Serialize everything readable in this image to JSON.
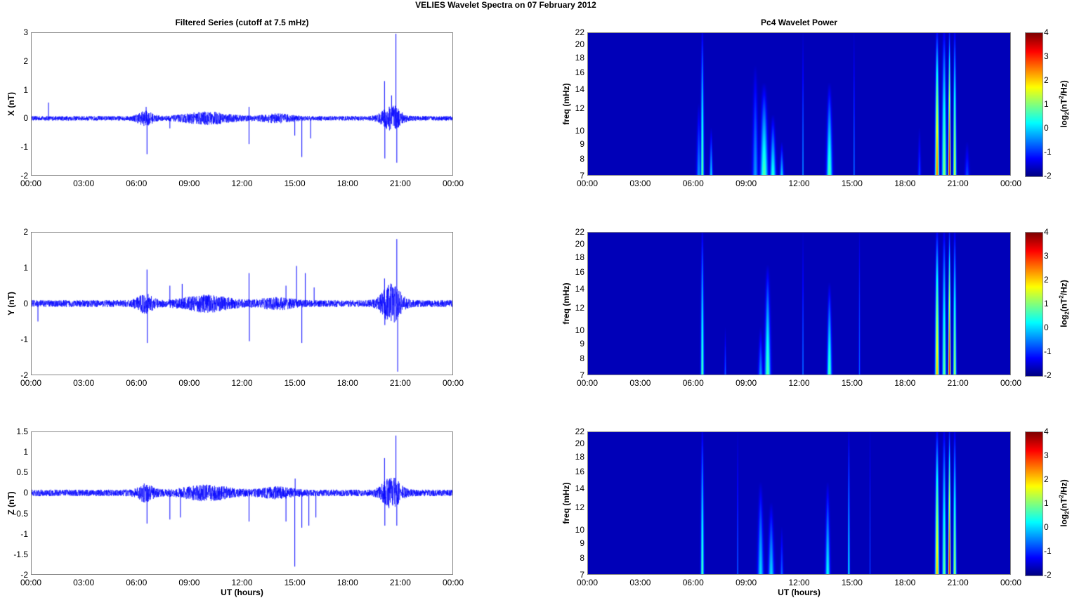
{
  "title": "VELIES Wavelet Spectra on 07 February  2012",
  "colors": {
    "trace": "#0000ff",
    "axis": "#888888"
  },
  "chart_data": [
    {
      "type": "line",
      "title": "Filtered Series (cutoff at 7.5 mHz)",
      "ylabel": "X (nT)",
      "xlabel": "",
      "ylim": [
        -2,
        3
      ],
      "yticks": [
        "-2",
        "-1",
        "0",
        "1",
        "2",
        "3"
      ],
      "ytick_values": [
        -2,
        -1,
        0,
        1,
        2,
        3
      ],
      "xlim": [
        0,
        24
      ],
      "xticks": [
        "00:00",
        "03:00",
        "06:00",
        "09:00",
        "12:00",
        "15:00",
        "18:00",
        "21:00",
        "00:00"
      ],
      "noise": 0.05,
      "bursts": [
        [
          6.5,
          0.12,
          0.5
        ],
        [
          10,
          0.1,
          1.5
        ],
        [
          14,
          0.06,
          1
        ],
        [
          20.5,
          0.25,
          0.6
        ]
      ],
      "spikes": [
        [
          1.0,
          0.55
        ],
        [
          6.55,
          0.4
        ],
        [
          6.6,
          -1.25
        ],
        [
          7.9,
          -0.35
        ],
        [
          12.4,
          -0.9
        ],
        [
          12.4,
          0.4
        ],
        [
          15.0,
          -0.6
        ],
        [
          15.4,
          -1.35
        ],
        [
          15.9,
          -0.7
        ],
        [
          20.1,
          1.3
        ],
        [
          20.12,
          -1.4
        ],
        [
          20.5,
          0.8
        ],
        [
          20.75,
          2.95
        ],
        [
          20.8,
          -1.55
        ]
      ]
    },
    {
      "type": "heatmap",
      "title": "Pc4 Wavelet Power",
      "ylabel": "freq (mHz)",
      "xlabel": "",
      "ylim": [
        7,
        22
      ],
      "yscale": "log",
      "yticks": [
        "7",
        "8",
        "9",
        "10",
        "12",
        "14",
        "16",
        "18",
        "20",
        "22"
      ],
      "ytick_values": [
        7,
        8,
        9,
        10,
        12,
        14,
        16,
        18,
        20,
        22
      ],
      "xlim": [
        0,
        24
      ],
      "xticks": [
        "00:00",
        "03:00",
        "06:00",
        "09:00",
        "12:00",
        "15:00",
        "18:00",
        "21:00",
        "00:00"
      ],
      "colorbar": {
        "label": "log2(nT2/Hz)",
        "range": [
          -2,
          4
        ],
        "ticks": [
          "-2",
          "-1",
          "0",
          "1",
          "2",
          "3",
          "4"
        ]
      },
      "events": [
        [
          6.5,
          1,
          22,
          0.08
        ],
        [
          6.3,
          -0.5,
          12,
          0.12
        ],
        [
          7.0,
          0,
          10,
          0.08
        ],
        [
          9.5,
          -0.5,
          16,
          0.15
        ],
        [
          10.0,
          0.8,
          14,
          0.2
        ],
        [
          10.5,
          0.5,
          11,
          0.15
        ],
        [
          11.0,
          0,
          9,
          0.1
        ],
        [
          12.2,
          0,
          22,
          0.03
        ],
        [
          13.7,
          0.8,
          14,
          0.15
        ],
        [
          15.1,
          -0.3,
          22,
          0.03
        ],
        [
          18.8,
          -1,
          10,
          0.08
        ],
        [
          19.8,
          3,
          22,
          0.1
        ],
        [
          20.2,
          1.2,
          22,
          0.12
        ],
        [
          20.5,
          4,
          22,
          0.06
        ],
        [
          20.8,
          1.8,
          22,
          0.08
        ],
        [
          21.5,
          -1,
          9,
          0.12
        ]
      ]
    },
    {
      "type": "line",
      "title": "",
      "ylabel": "Y (nT)",
      "xlabel": "",
      "ylim": [
        -2,
        2
      ],
      "yticks": [
        "-2",
        "-1",
        "0",
        "1",
        "2"
      ],
      "ytick_values": [
        -2,
        -1,
        0,
        1,
        2
      ],
      "xlim": [
        0,
        24
      ],
      "xticks": [
        "00:00",
        "03:00",
        "06:00",
        "09:00",
        "12:00",
        "15:00",
        "18:00",
        "21:00",
        "00:00"
      ],
      "noise": 0.06,
      "bursts": [
        [
          6.5,
          0.12,
          0.5
        ],
        [
          10,
          0.1,
          1.5
        ],
        [
          14,
          0.06,
          1
        ],
        [
          20.5,
          0.3,
          0.6
        ]
      ],
      "spikes": [
        [
          0.4,
          -0.5
        ],
        [
          6.6,
          0.95
        ],
        [
          6.62,
          -1.1
        ],
        [
          7.9,
          0.5
        ],
        [
          8.6,
          0.55
        ],
        [
          12.4,
          0.85
        ],
        [
          12.42,
          -1.05
        ],
        [
          14.5,
          0.5
        ],
        [
          15.1,
          1.05
        ],
        [
          15.4,
          -1.1
        ],
        [
          15.6,
          0.85
        ],
        [
          16.1,
          0.45
        ],
        [
          20.1,
          0.7
        ],
        [
          20.12,
          -0.6
        ],
        [
          20.8,
          1.8
        ],
        [
          20.85,
          -1.9
        ]
      ]
    },
    {
      "type": "heatmap",
      "title": "",
      "ylabel": "freq (mHz)",
      "xlabel": "",
      "ylim": [
        7,
        22
      ],
      "yscale": "log",
      "yticks": [
        "7",
        "8",
        "9",
        "10",
        "12",
        "14",
        "16",
        "18",
        "20",
        "22"
      ],
      "ytick_values": [
        7,
        8,
        9,
        10,
        12,
        14,
        16,
        18,
        20,
        22
      ],
      "xlim": [
        0,
        24
      ],
      "xticks": [
        "00:00",
        "03:00",
        "06:00",
        "09:00",
        "12:00",
        "15:00",
        "18:00",
        "21:00",
        "00:00"
      ],
      "colorbar": {
        "label": "log2(nT2/Hz)",
        "range": [
          -2,
          4
        ],
        "ticks": [
          "-2",
          "-1",
          "0",
          "1",
          "2",
          "3",
          "4"
        ]
      },
      "events": [
        [
          6.5,
          0.8,
          22,
          0.08
        ],
        [
          7.8,
          -0.8,
          10,
          0.05
        ],
        [
          9.8,
          -0.5,
          10,
          0.12
        ],
        [
          10.2,
          0.8,
          16,
          0.15
        ],
        [
          12.2,
          -0.3,
          22,
          0.03
        ],
        [
          13.7,
          0.8,
          14,
          0.12
        ],
        [
          15.4,
          -0.8,
          22,
          0.04
        ],
        [
          19.8,
          2.5,
          22,
          0.1
        ],
        [
          20.2,
          1,
          22,
          0.1
        ],
        [
          20.5,
          3.8,
          22,
          0.06
        ],
        [
          20.8,
          1.5,
          22,
          0.08
        ]
      ]
    },
    {
      "type": "line",
      "title": "",
      "ylabel": "Z (nT)",
      "xlabel": "UT (hours)",
      "ylim": [
        -2,
        1.5
      ],
      "yticks": [
        "-2",
        "-1.5",
        "-1",
        "-0.5",
        "0",
        "0.5",
        "1",
        "1.5"
      ],
      "ytick_values": [
        -2,
        -1.5,
        -1,
        -0.5,
        0,
        0.5,
        1,
        1.5
      ],
      "xlim": [
        0,
        24
      ],
      "xticks": [
        "00:00",
        "03:00",
        "06:00",
        "09:00",
        "12:00",
        "15:00",
        "18:00",
        "21:00",
        "00:00"
      ],
      "noise": 0.05,
      "bursts": [
        [
          6.5,
          0.1,
          0.5
        ],
        [
          10,
          0.08,
          1.5
        ],
        [
          14,
          0.05,
          1
        ],
        [
          20.5,
          0.2,
          0.6
        ]
      ],
      "spikes": [
        [
          6.6,
          -0.75
        ],
        [
          7.9,
          -0.65
        ],
        [
          8.5,
          -0.6
        ],
        [
          12.4,
          -0.7
        ],
        [
          14.5,
          -0.7
        ],
        [
          15.0,
          -1.8
        ],
        [
          15.02,
          0.35
        ],
        [
          15.4,
          -0.85
        ],
        [
          15.8,
          -0.8
        ],
        [
          16.2,
          -0.6
        ],
        [
          20.1,
          0.85
        ],
        [
          20.12,
          -0.8
        ],
        [
          20.75,
          1.4
        ],
        [
          20.8,
          -0.8
        ]
      ]
    },
    {
      "type": "heatmap",
      "title": "",
      "ylabel": "freq (mHz)",
      "xlabel": "UT (hours)",
      "ylim": [
        7,
        22
      ],
      "yscale": "log",
      "yticks": [
        "7",
        "8",
        "9",
        "10",
        "12",
        "14",
        "16",
        "18",
        "20",
        "22"
      ],
      "ytick_values": [
        7,
        8,
        9,
        10,
        12,
        14,
        16,
        18,
        20,
        22
      ],
      "xlim": [
        0,
        24
      ],
      "xticks": [
        "00:00",
        "03:00",
        "06:00",
        "09:00",
        "12:00",
        "15:00",
        "18:00",
        "21:00",
        "00:00"
      ],
      "colorbar": {
        "label": "log2(nT2/Hz)",
        "range": [
          -2,
          4
        ],
        "ticks": [
          "-2",
          "-1",
          "0",
          "1",
          "2",
          "3",
          "4"
        ]
      },
      "events": [
        [
          6.5,
          0.8,
          22,
          0.08
        ],
        [
          8.5,
          -0.5,
          22,
          0.03
        ],
        [
          9.8,
          0,
          14,
          0.15
        ],
        [
          10.4,
          0,
          12,
          0.15
        ],
        [
          11.0,
          -0.8,
          10,
          0.08
        ],
        [
          13.6,
          0.3,
          14,
          0.12
        ],
        [
          14.8,
          0.3,
          22,
          0.05
        ],
        [
          16.0,
          -1,
          22,
          0.03
        ],
        [
          19.8,
          2.5,
          22,
          0.1
        ],
        [
          20.2,
          1,
          22,
          0.1
        ],
        [
          20.5,
          3.8,
          22,
          0.06
        ],
        [
          20.8,
          1.5,
          22,
          0.08
        ]
      ]
    }
  ]
}
